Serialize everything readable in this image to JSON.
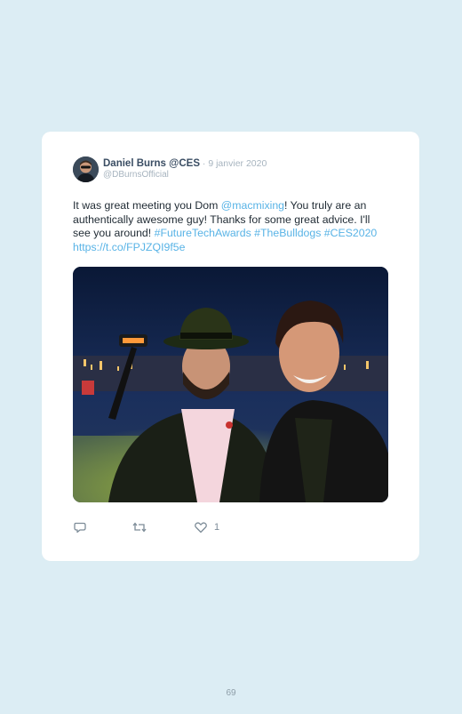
{
  "tweet": {
    "author_name": "Daniel Burns @CES",
    "separator": " · ",
    "date": "9 janvier 2020",
    "handle": "@DBurnsOfficial",
    "text_parts": [
      {
        "text": "It was great meeting you Dom ",
        "link": false
      },
      {
        "text": "@macmixing",
        "link": true
      },
      {
        "text": "! You truly are an authentically awesome guy! Thanks for some great advice. I'll see you around! ",
        "link": false
      },
      {
        "text": "#FutureTechAwards",
        "link": true
      },
      {
        "text": " ",
        "link": false
      },
      {
        "text": "#TheBulldogs",
        "link": true
      },
      {
        "text": " ",
        "link": false
      },
      {
        "text": "#CES2020",
        "link": true
      },
      {
        "text": " ",
        "link": false
      },
      {
        "text": "https://t.co/FPJZQI9f5e",
        "link": true
      }
    ],
    "photo_icon": "selfie-photo",
    "actions": {
      "reply_icon": "reply-icon",
      "retweet_icon": "retweet-icon",
      "like_icon": "heart-icon",
      "like_count": "1"
    }
  },
  "colors": {
    "page_background": "#dcedf4",
    "card_background": "#ffffff",
    "link": "#58b3e6",
    "name": "#3a4d63",
    "muted": "#a7b4bf"
  },
  "page": {
    "number": "69"
  }
}
